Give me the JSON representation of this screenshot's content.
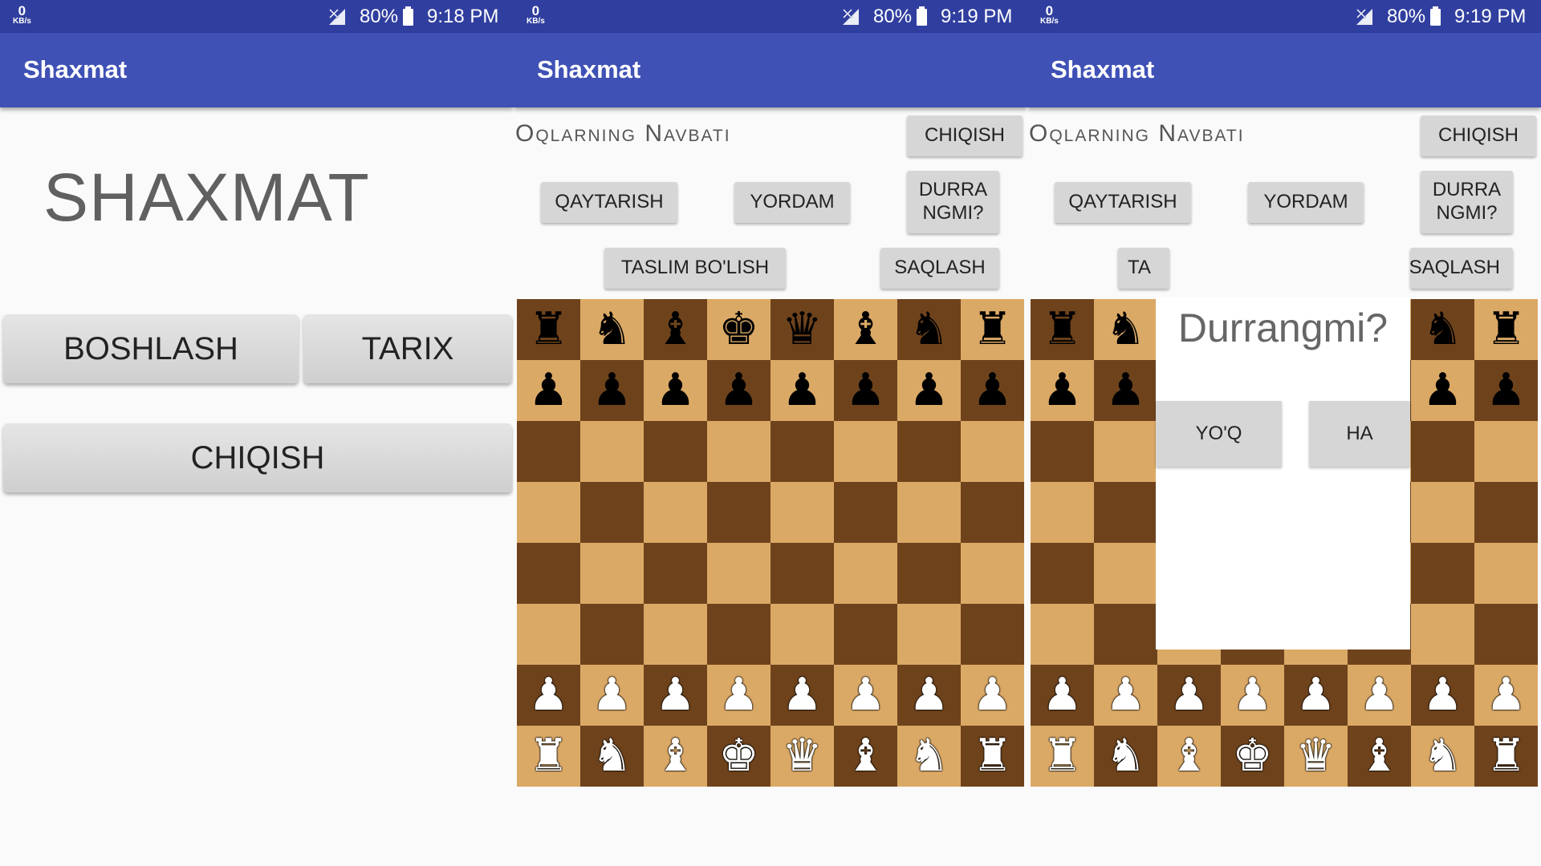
{
  "status_bars": [
    {
      "speed": "0",
      "speed_unit": "KB/s",
      "battery": "80%",
      "time": "9:18 PM"
    },
    {
      "speed": "0",
      "speed_unit": "KB/s",
      "battery": "80%",
      "time": "9:19 PM"
    },
    {
      "speed": "0",
      "speed_unit": "KB/s",
      "battery": "80%",
      "time": "9:19 PM"
    }
  ],
  "app_title": "Shaxmat",
  "menu": {
    "title": "SHAXMAT",
    "start_label": "BOSHLASH",
    "history_label": "TARIX",
    "exit_label": "CHIQISH"
  },
  "game": {
    "turn_label": "Oqlarning Navbati",
    "exit_label": "CHIQISH",
    "undo_label": "QAYTARISH",
    "help_label": "YORDAM",
    "draw_label": "DURRA NGMI?",
    "resign_label": "TASLIM BO'LISH",
    "save_label": "SAQLASH"
  },
  "game_partial": {
    "resign_label_visible": "TA",
    "save_label_visible": "SAQLASH"
  },
  "dialog": {
    "title": "Durrangmi?",
    "no_label": "YO'Q",
    "yes_label": "HA"
  },
  "board": [
    [
      "♜",
      "♞",
      "♝",
      "♚",
      "♛",
      "♝",
      "♞",
      "♜"
    ],
    [
      "♟",
      "♟",
      "♟",
      "♟",
      "♟",
      "♟",
      "♟",
      "♟"
    ],
    [
      "",
      "",
      "",
      "",
      "",
      "",
      "",
      ""
    ],
    [
      "",
      "",
      "",
      "",
      "",
      "",
      "",
      ""
    ],
    [
      "",
      "",
      "",
      "",
      "",
      "",
      "",
      ""
    ],
    [
      "",
      "",
      "",
      "",
      "",
      "",
      "",
      ""
    ],
    [
      "♙",
      "♙",
      "♙",
      "♙",
      "♙",
      "♙",
      "♙",
      "♙"
    ],
    [
      "♖",
      "♘",
      "♗",
      "♔",
      "♕",
      "♗",
      "♘",
      "♖"
    ]
  ],
  "colors": {
    "status_bar": "#303f9f",
    "app_bar": "#3f51b5",
    "light_square": "#dba966",
    "dark_square": "#6e431c",
    "button": "#d6d6d6"
  }
}
